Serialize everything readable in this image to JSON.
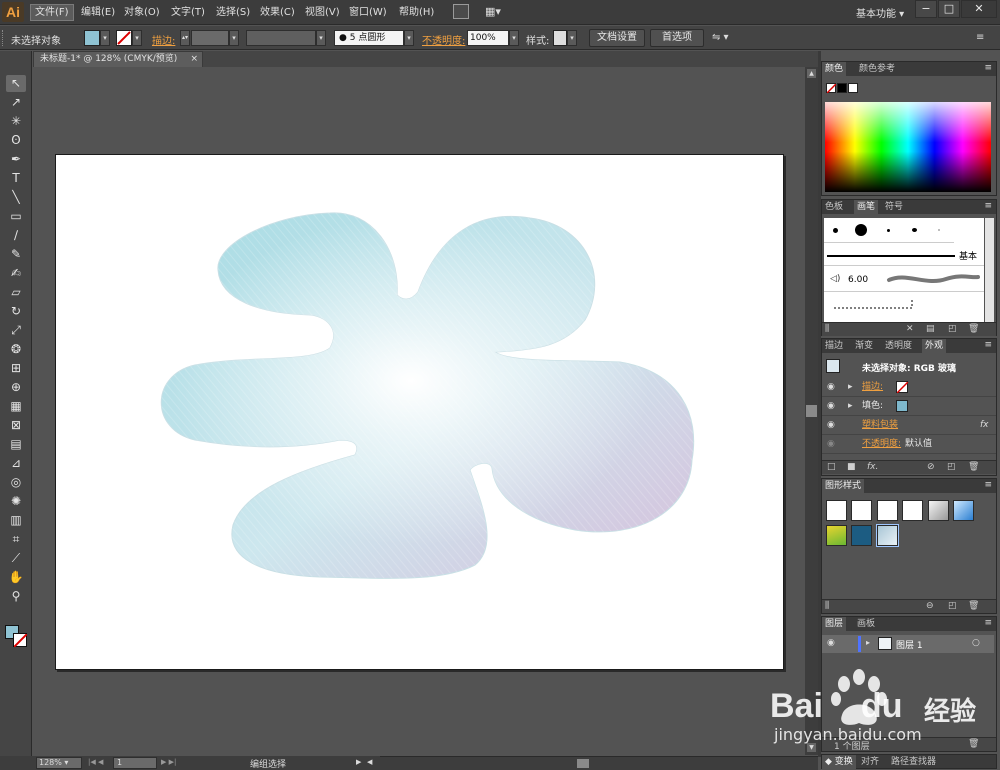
{
  "app": {
    "logo": "Ai",
    "workspace": "基本功能"
  },
  "menu": [
    "文件(F)",
    "编辑(E)",
    "对象(O)",
    "文字(T)",
    "选择(S)",
    "效果(C)",
    "视图(V)",
    "窗口(W)",
    "帮助(H)"
  ],
  "window_buttons": {
    "minimize": "−",
    "maximize": "□",
    "close": "✕"
  },
  "control": {
    "selection_state": "未选择对象",
    "stroke_label": "描边:",
    "brush_value": "5 点圆形",
    "brush_dot": "●",
    "opacity_label": "不透明度:",
    "opacity_value": "100%",
    "style_label": "样式:",
    "doc_setup": "文档设置",
    "preferences": "首选项"
  },
  "document": {
    "tab_title": "未标题-1* @ 128% (CMYK/预览)",
    "tab_close": "×",
    "zoom": "128%",
    "page": "1",
    "status": "编组选择"
  },
  "tools": [
    {
      "name": "selection-tool",
      "glyph": "↖"
    },
    {
      "name": "direct-selection-tool",
      "glyph": "↗"
    },
    {
      "name": "magic-wand-tool",
      "glyph": "✳"
    },
    {
      "name": "lasso-tool",
      "glyph": "ʘ"
    },
    {
      "name": "pen-tool",
      "glyph": "✒"
    },
    {
      "name": "type-tool",
      "glyph": "T"
    },
    {
      "name": "line-tool",
      "glyph": "╲"
    },
    {
      "name": "rectangle-tool",
      "glyph": "▭"
    },
    {
      "name": "paintbrush-tool",
      "glyph": "∕"
    },
    {
      "name": "pencil-tool",
      "glyph": "✎"
    },
    {
      "name": "blob-brush-tool",
      "glyph": "✍"
    },
    {
      "name": "eraser-tool",
      "glyph": "▱"
    },
    {
      "name": "rotate-tool",
      "glyph": "↻"
    },
    {
      "name": "scale-tool",
      "glyph": "⤢"
    },
    {
      "name": "warp-tool",
      "glyph": "❂"
    },
    {
      "name": "free-transform-tool",
      "glyph": "⊞"
    },
    {
      "name": "shape-builder-tool",
      "glyph": "⊕"
    },
    {
      "name": "perspective-grid-tool",
      "glyph": "▦"
    },
    {
      "name": "mesh-tool",
      "glyph": "⊠"
    },
    {
      "name": "gradient-tool",
      "glyph": "▤"
    },
    {
      "name": "eyedropper-tool",
      "glyph": "⊿"
    },
    {
      "name": "blend-tool",
      "glyph": "◎"
    },
    {
      "name": "symbol-sprayer-tool",
      "glyph": "✺"
    },
    {
      "name": "column-graph-tool",
      "glyph": "▥"
    },
    {
      "name": "artboard-tool",
      "glyph": "⌗"
    },
    {
      "name": "slice-tool",
      "glyph": "⟋"
    },
    {
      "name": "hand-tool",
      "glyph": "✋"
    },
    {
      "name": "zoom-tool",
      "glyph": "⚲"
    }
  ],
  "panels": {
    "color": {
      "tabs": [
        "颜色",
        "颜色参考"
      ]
    },
    "brushes": {
      "tabs": [
        "色板",
        "画笔",
        "符号"
      ],
      "basic_label": "基本",
      "stroke_size": "6.00"
    },
    "appearance": {
      "tabs": [
        "描边",
        "渐变",
        "透明度",
        "外观"
      ],
      "header": "未选择对象: RGB 玻璃",
      "rows": [
        {
          "label": "描边:",
          "value": ""
        },
        {
          "label": "填色:",
          "value": ""
        },
        {
          "label": "塑料包装",
          "value": ""
        },
        {
          "label": "不透明度:",
          "value": "默认值"
        }
      ],
      "fx": "fx"
    },
    "graphic_styles": {
      "tabs": [
        "图形样式"
      ]
    },
    "layers": {
      "tabs": [
        "图层",
        "画板"
      ],
      "layer_name": "图层 1",
      "footer": "1 个图层"
    },
    "transform": {
      "tabs": [
        "变换",
        "对齐",
        "路径查找器"
      ]
    }
  },
  "watermark": {
    "brand_a": "Bai",
    "brand_b": "du",
    "brand_cn": "经验",
    "url": "jingyan.baidu.com"
  },
  "colors": {
    "ui_dark": "#3c3c3c",
    "panel": "#535353",
    "link_orange": "#f0a040",
    "shape_cyan": "#a7dbe3",
    "shape_lilac": "#d6bedb"
  }
}
